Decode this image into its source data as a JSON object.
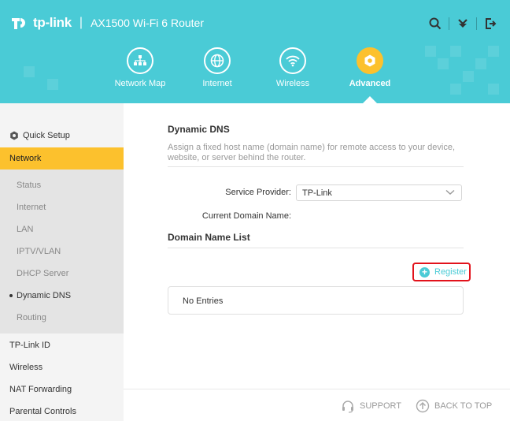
{
  "header": {
    "brand": "tp-link",
    "separator": "|",
    "model": "AX1500 Wi-Fi 6 Router",
    "icons": [
      "search-icon",
      "download-icon",
      "logout-icon"
    ],
    "tabs": [
      {
        "label": "Network Map",
        "icon": "network-map-icon"
      },
      {
        "label": "Internet",
        "icon": "globe-icon"
      },
      {
        "label": "Wireless",
        "icon": "wifi-icon"
      },
      {
        "label": "Advanced",
        "icon": "gear-icon",
        "active": true
      }
    ],
    "colors": {
      "bar": "#4acbd6",
      "accent": "#fcc12d"
    }
  },
  "sidebar": {
    "quick_setup": "Quick Setup",
    "network": "Network",
    "network_children": [
      "Status",
      "Internet",
      "LAN",
      "IPTV/VLAN",
      "DHCP Server",
      "Dynamic DNS",
      "Routing"
    ],
    "current_child": "Dynamic DNS",
    "items": [
      "TP-Link ID",
      "Wireless",
      "NAT Forwarding",
      "Parental Controls"
    ]
  },
  "main": {
    "title": "Dynamic DNS",
    "description": "Assign a fixed host name (domain name) for remote access to your device, website, or server behind the router.",
    "service_provider_label": "Service Provider:",
    "service_provider_value": "TP-Link",
    "current_domain_label": "Current Domain Name:",
    "current_domain_value": "",
    "list_title": "Domain Name List",
    "register_label": "Register",
    "no_entries": "No Entries"
  },
  "footer": {
    "support": "SUPPORT",
    "back_to_top": "BACK TO TOP"
  }
}
